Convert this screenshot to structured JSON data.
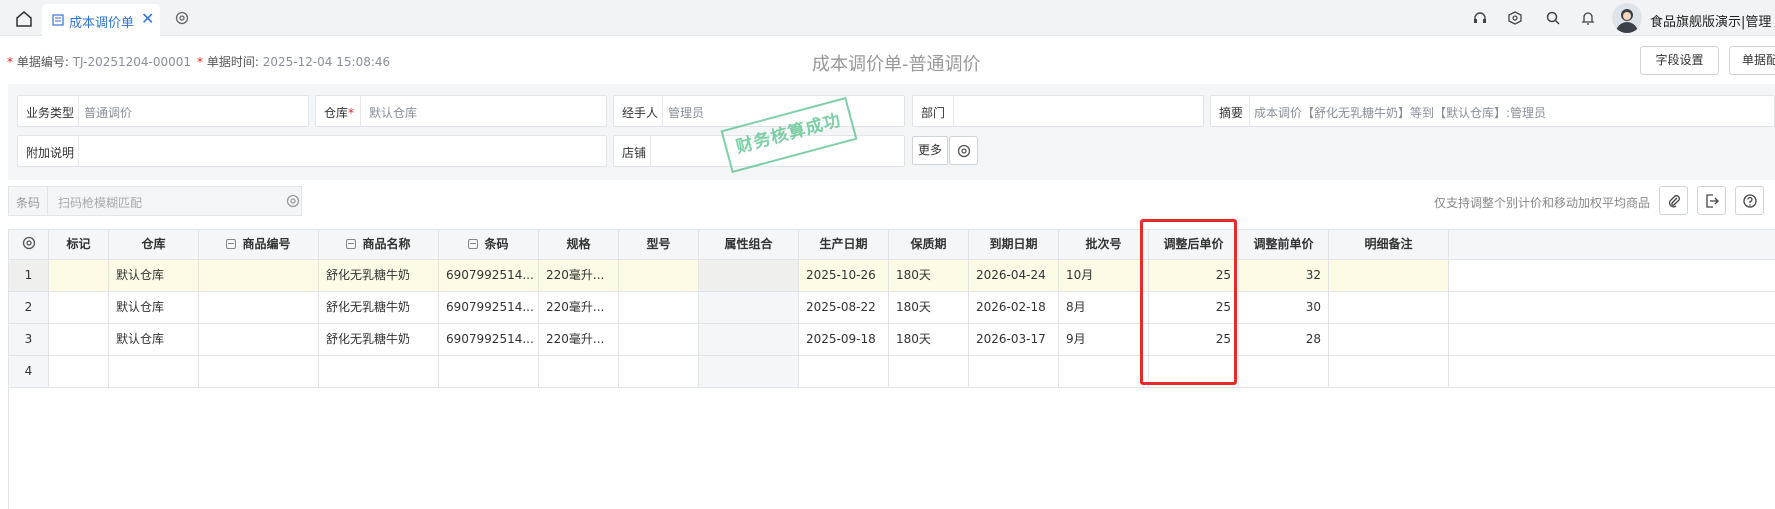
{
  "tabs": {
    "active_label": "成本调价单",
    "close_glyph": "✕"
  },
  "user": {
    "name": "食品旗舰版演示|管理"
  },
  "header": {
    "doc_no_label": "单据编号:",
    "doc_no": "TJ-20251204-00001",
    "doc_time_label": "单据时间:",
    "doc_time": "2025-12-04 15:08:46",
    "title": "成本调价单-普通调价",
    "field_settings_btn": "字段设置",
    "doc_btn_partial": "单据配"
  },
  "form": {
    "biz_type_label": "业务类型",
    "biz_type": "普通调价",
    "warehouse_label": "仓库",
    "warehouse": "默认仓库",
    "handler_label": "经手人",
    "handler": "管理员",
    "dept_label": "部门",
    "summary_label": "摘要",
    "summary": "成本调价【舒化无乳糖牛奶】等到【默认仓库】:管理员",
    "extra_label": "附加说明",
    "shop_label": "店铺",
    "more_btn": "更多",
    "stamp_text": "财务核算成功"
  },
  "barcode": {
    "label": "条码",
    "placeholder": "扫码枪模糊匹配"
  },
  "hint": "仅支持调整个别计价和移动加权平均商品",
  "table": {
    "headers": [
      "标记",
      "仓库",
      "商品编号",
      "商品名称",
      "条码",
      "规格",
      "型号",
      "属性组合",
      "生产日期",
      "保质期",
      "到期日期",
      "批次号",
      "调整后单价",
      "调整前单价",
      "明细备注"
    ],
    "rows": [
      {
        "no": "1",
        "warehouse": "默认仓库",
        "name": "舒化无乳糖牛奶",
        "barcode": "6907992514...",
        "spec": "220毫升...",
        "prod_date": "2025-10-26",
        "shelf": "180天",
        "exp_date": "2026-04-24",
        "batch": "10月",
        "after": "25",
        "before": "32"
      },
      {
        "no": "2",
        "warehouse": "默认仓库",
        "name": "舒化无乳糖牛奶",
        "barcode": "6907992514...",
        "spec": "220毫升...",
        "prod_date": "2025-08-22",
        "shelf": "180天",
        "exp_date": "2026-02-18",
        "batch": "8月",
        "after": "25",
        "before": "30"
      },
      {
        "no": "3",
        "warehouse": "默认仓库",
        "name": "舒化无乳糖牛奶",
        "barcode": "6907992514...",
        "spec": "220毫升...",
        "prod_date": "2025-09-18",
        "shelf": "180天",
        "exp_date": "2026-03-17",
        "batch": "9月",
        "after": "25",
        "before": "28"
      },
      {
        "no": "4"
      }
    ]
  },
  "colors": {
    "accent": "#2f74d6",
    "required": "#e02020",
    "highlight": "#e52b2b",
    "stamp": "#55c089"
  }
}
